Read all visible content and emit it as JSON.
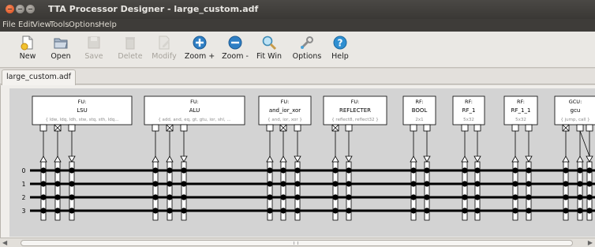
{
  "window": {
    "title": "TTA Processor Designer - large_custom.adf"
  },
  "menus": [
    "File",
    "Edit",
    "View",
    "Tools",
    "Options",
    "Help"
  ],
  "toolbar": [
    {
      "label": "New",
      "icon": "new-document-icon",
      "enabled": true
    },
    {
      "label": "Open",
      "icon": "open-folder-icon",
      "enabled": true
    },
    {
      "label": "Save",
      "icon": "save-disk-icon",
      "enabled": false
    },
    {
      "label": "Delete",
      "icon": "trash-can-icon",
      "enabled": false
    },
    {
      "label": "Modify",
      "icon": "edit-pencil-icon",
      "enabled": false
    },
    {
      "label": "Zoom +",
      "icon": "zoom-in-icon",
      "enabled": true
    },
    {
      "label": "Zoom -",
      "icon": "zoom-out-icon",
      "enabled": true
    },
    {
      "label": "Fit Win",
      "icon": "fit-window-icon",
      "enabled": true
    },
    {
      "label": "Options",
      "icon": "options-wrench-icon",
      "enabled": true
    },
    {
      "label": "Help",
      "icon": "help-icon",
      "enabled": true
    }
  ],
  "tabs": [
    "large_custom.adf"
  ],
  "buses": [
    "0",
    "1",
    "2",
    "3"
  ],
  "units": [
    {
      "kind": "FU:",
      "name": "LSU",
      "ops": "{ ldw, ldq, ldh, stw, stq, sth, ldq...",
      "ports": [
        "out",
        "trigger",
        "in"
      ]
    },
    {
      "kind": "FU:",
      "name": "ALU",
      "ops": "{ add, and, eq, gt, gtu, ior, shl, ...",
      "ports": [
        "out",
        "trigger",
        "in"
      ]
    },
    {
      "kind": "FU:",
      "name": "and_ior_xor",
      "ops": "{ and, ior, xor }",
      "ports": [
        "out",
        "trigger",
        "in"
      ]
    },
    {
      "kind": "FU:",
      "name": "REFLECTER",
      "ops": "{ reflect8, reflect32 }",
      "ports": [
        "trigger",
        "in"
      ]
    },
    {
      "kind": "RF:",
      "name": "BOOL",
      "ops": "2x1",
      "ports": [
        "out",
        "in"
      ]
    },
    {
      "kind": "RF:",
      "name": "RF_1",
      "ops": "5x32",
      "ports": [
        "out",
        "in"
      ]
    },
    {
      "kind": "RF:",
      "name": "RF_1_1",
      "ops": "5x32",
      "ports": [
        "out",
        "in"
      ]
    },
    {
      "kind": "GCU:",
      "name": "gcu",
      "ops": "{ jump, call }",
      "ports": [
        "trigger",
        "out",
        "in"
      ]
    }
  ],
  "colors": {
    "titlebar": "#3c3b37",
    "canvas_bg": "#d3d3d3",
    "unit_box": "#ffffff",
    "ops_text": "#8a8a8a",
    "bus": "#000000"
  }
}
